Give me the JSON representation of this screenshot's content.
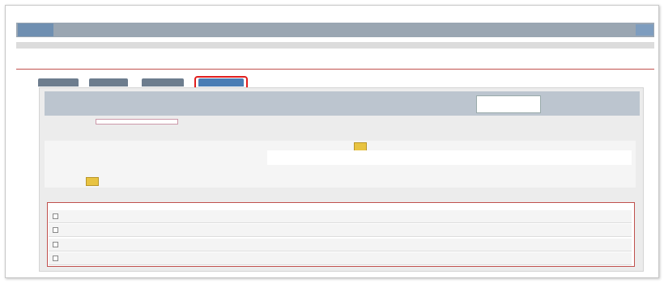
{
  "header": {
    "logo_text": "",
    "title": "",
    "user_label": "",
    "icon_label": ""
  },
  "info": {
    "labels": [
      "",
      "",
      ""
    ],
    "values": [
      "",
      "",
      ""
    ]
  },
  "tabs": [
    {
      "label": ""
    },
    {
      "label": ""
    },
    {
      "label": ""
    },
    {
      "label": ""
    }
  ],
  "panel": {
    "title": "",
    "search_placeholder": "",
    "side_links": [
      "",
      "",
      ""
    ]
  },
  "filter": {
    "label": "",
    "value": "",
    "link": ""
  },
  "note": "",
  "detail": {
    "labels": [
      "",
      "",
      "",
      "",
      ""
    ],
    "header": "",
    "text_line1": "",
    "text_line2": ""
  },
  "table": {
    "caption": "",
    "headers": [
      "",
      "",
      "",
      "",
      ""
    ],
    "rows": [
      {
        "id": "",
        "date": "",
        "time": "",
        "state": "",
        "note": "",
        "action": ""
      },
      {
        "id": "",
        "date": "",
        "time": "",
        "state": "",
        "note": "",
        "action": ""
      },
      {
        "id": "",
        "date": "",
        "time": "",
        "state": "",
        "note": "",
        "action": ""
      },
      {
        "id": "",
        "date": "",
        "time": "",
        "state": "",
        "note": "",
        "action": ""
      }
    ]
  },
  "colors": {
    "header_bg": "#9aa6b2",
    "accent_red": "#c0504d",
    "tab_active": "#4a7db5",
    "highlight_box": "#e01e1e"
  }
}
